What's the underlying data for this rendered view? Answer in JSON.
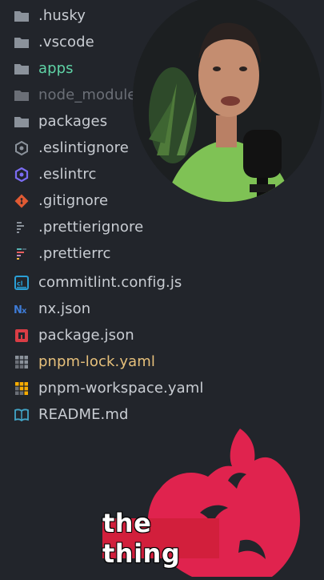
{
  "explorer": {
    "items": [
      {
        "label": ".husky",
        "icon": "folder-icon",
        "style": "normal"
      },
      {
        "label": ".vscode",
        "icon": "folder-icon",
        "style": "normal"
      },
      {
        "label": "apps",
        "icon": "folder-icon",
        "style": "green"
      },
      {
        "label": "node_modules",
        "icon": "folder-icon",
        "style": "dim"
      },
      {
        "label": "packages",
        "icon": "folder-icon",
        "style": "normal"
      },
      {
        "label": ".eslintignore",
        "icon": "eslint-icon",
        "style": "normal"
      },
      {
        "label": ".eslintrc",
        "icon": "eslint-config-icon",
        "style": "normal"
      },
      {
        "label": ".gitignore",
        "icon": "git-icon",
        "style": "normal"
      },
      {
        "label": ".prettierignore",
        "icon": "prettier-ignore-icon",
        "style": "normal"
      },
      {
        "label": ".prettierrc",
        "icon": "prettier-icon",
        "style": "normal"
      },
      {
        "label": "commitlint.config.js",
        "icon": "commitlint-icon",
        "style": "normal"
      },
      {
        "label": "nx.json",
        "icon": "nx-icon",
        "style": "normal"
      },
      {
        "label": "package.json",
        "icon": "npm-icon",
        "style": "normal"
      },
      {
        "label": "pnpm-lock.yaml",
        "icon": "pnpm-lock-icon",
        "style": "yellow"
      },
      {
        "label": "pnpm-workspace.yaml",
        "icon": "pnpm-icon",
        "style": "normal"
      },
      {
        "label": "README.md",
        "icon": "readme-book-icon",
        "style": "normal"
      }
    ]
  },
  "caption": {
    "text": "the thing"
  },
  "colors": {
    "background": "#22252b",
    "text": "#c9cdd3",
    "green": "#5fd3a6",
    "dim": "#6b6f77",
    "yellow": "#e6c07b",
    "nest_red": "#e0234e",
    "caption_bg": "#d21f3c"
  }
}
